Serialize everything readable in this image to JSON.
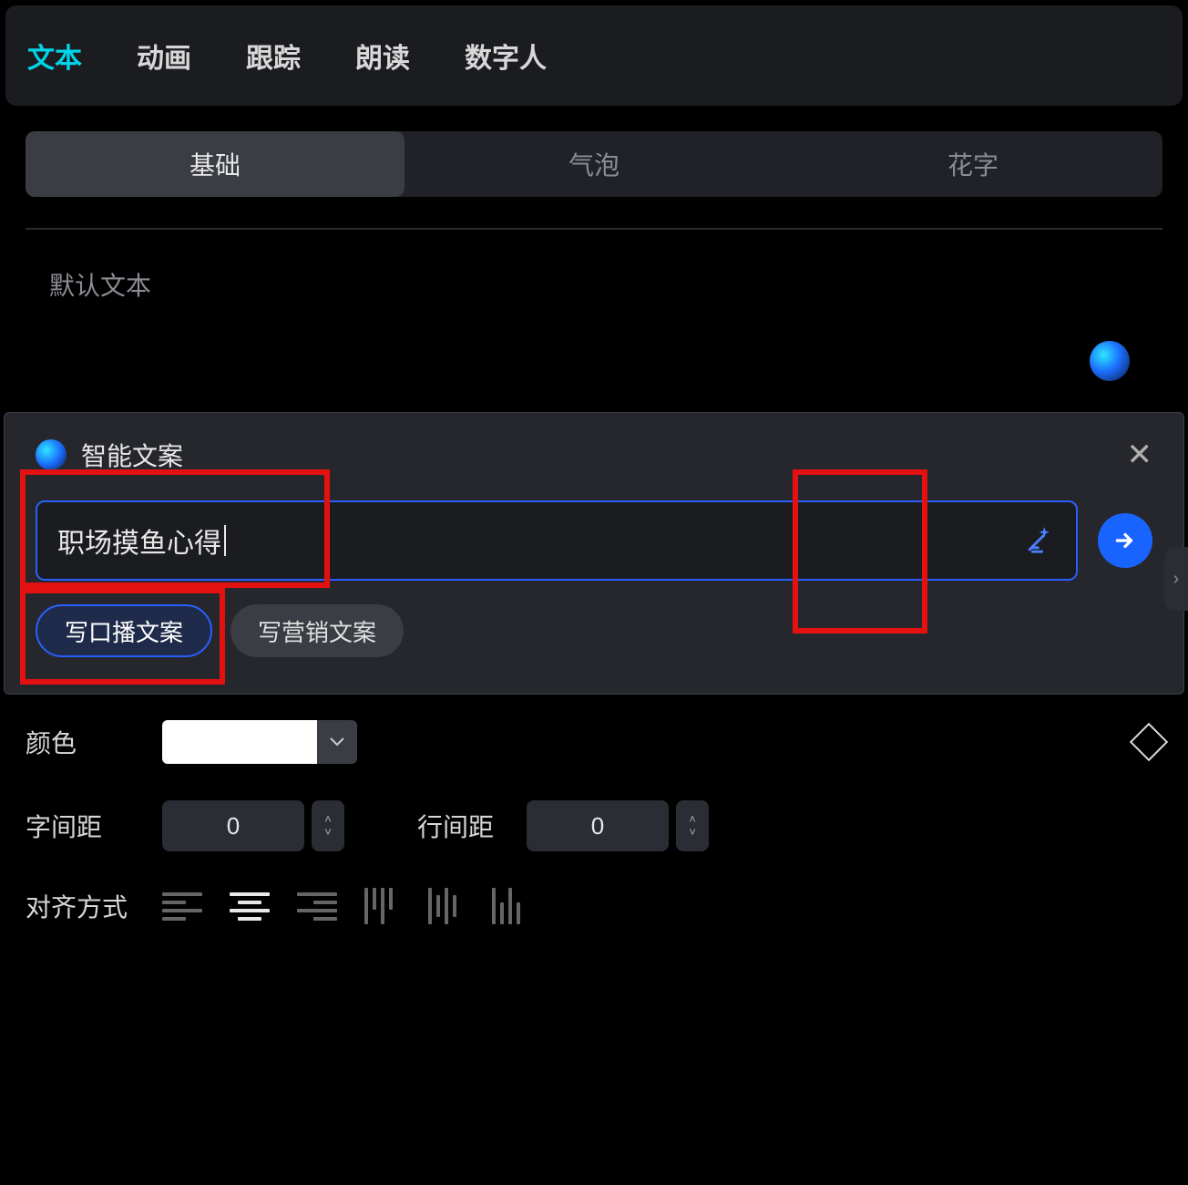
{
  "top_tabs": {
    "text": "文本",
    "animation": "动画",
    "track": "跟踪",
    "read": "朗读",
    "digital": "数字人",
    "active": "text"
  },
  "sub_tabs": {
    "basic": "基础",
    "bubble": "气泡",
    "fancy": "花字",
    "active": "basic"
  },
  "textbox": {
    "placeholder": "默认文本"
  },
  "popup": {
    "title": "智能文案",
    "input_value": "职场摸鱼心得",
    "chips": {
      "voice": "写口播文案",
      "marketing": "写营销文案",
      "active": "voice"
    }
  },
  "controls": {
    "color_label": "颜色",
    "color_value": "#FFFFFF",
    "letter_spacing_label": "字间距",
    "letter_spacing_value": "0",
    "line_spacing_label": "行间距",
    "line_spacing_value": "0",
    "align_label": "对齐方式"
  }
}
